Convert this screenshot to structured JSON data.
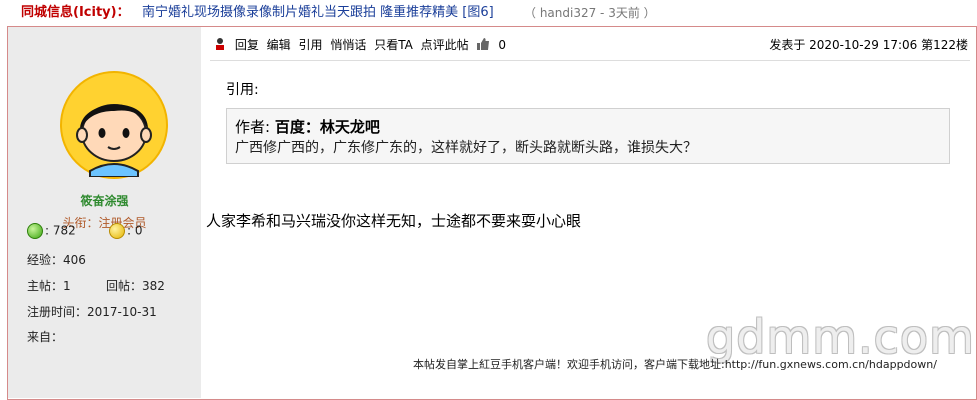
{
  "header": {
    "forum": "同城信息(Icity)：",
    "title": "南宁婚礼现场摄像录像制片婚礼当天跟拍 隆重推荐精美 [图6]",
    "meta": "（ handi327 - 3天前 ）"
  },
  "author": {
    "name": "筱奋涂强",
    "rank": "头衔：注册会员",
    "points_green": ": 782",
    "points_yellow": ": 0",
    "exp": "经验：406",
    "topics": "主帖：1",
    "replies": "回帖：382",
    "registered": "注册时间：2017-10-31",
    "from": "来自："
  },
  "toolbar": {
    "reply": "回复",
    "edit": "编辑",
    "quote": "引用",
    "whisper": "悄悄话",
    "only_author": "只看TA",
    "comment": "点评此帖",
    "likes": "0"
  },
  "post": {
    "posted_at": "发表于 2020-10-29 17:06 第122楼",
    "quote_label": "引用:",
    "quote_author_prefix": "作者: ",
    "quote_author": "百度：林天龙吧",
    "quote_text": "广西修广西的，广东修广东的，这样就好了，断头路就断头路，谁损失大？",
    "body": "人家李希和马兴瑞没你这样无知，士途都不要来耍小心眼",
    "footer": "本帖发自掌上紅豆手机客户端！欢迎手机访问，客户端下载地址:http://fun.gxnews.com.cn/hdappdown/",
    "watermark": "gdmm.com"
  },
  "colors": {
    "forum_red": "#c00000",
    "title_blue": "#1a3e99",
    "frame_border": "#d58a8a",
    "sidebar_bg": "#ebebeb",
    "username_green": "#2f8a2f"
  }
}
